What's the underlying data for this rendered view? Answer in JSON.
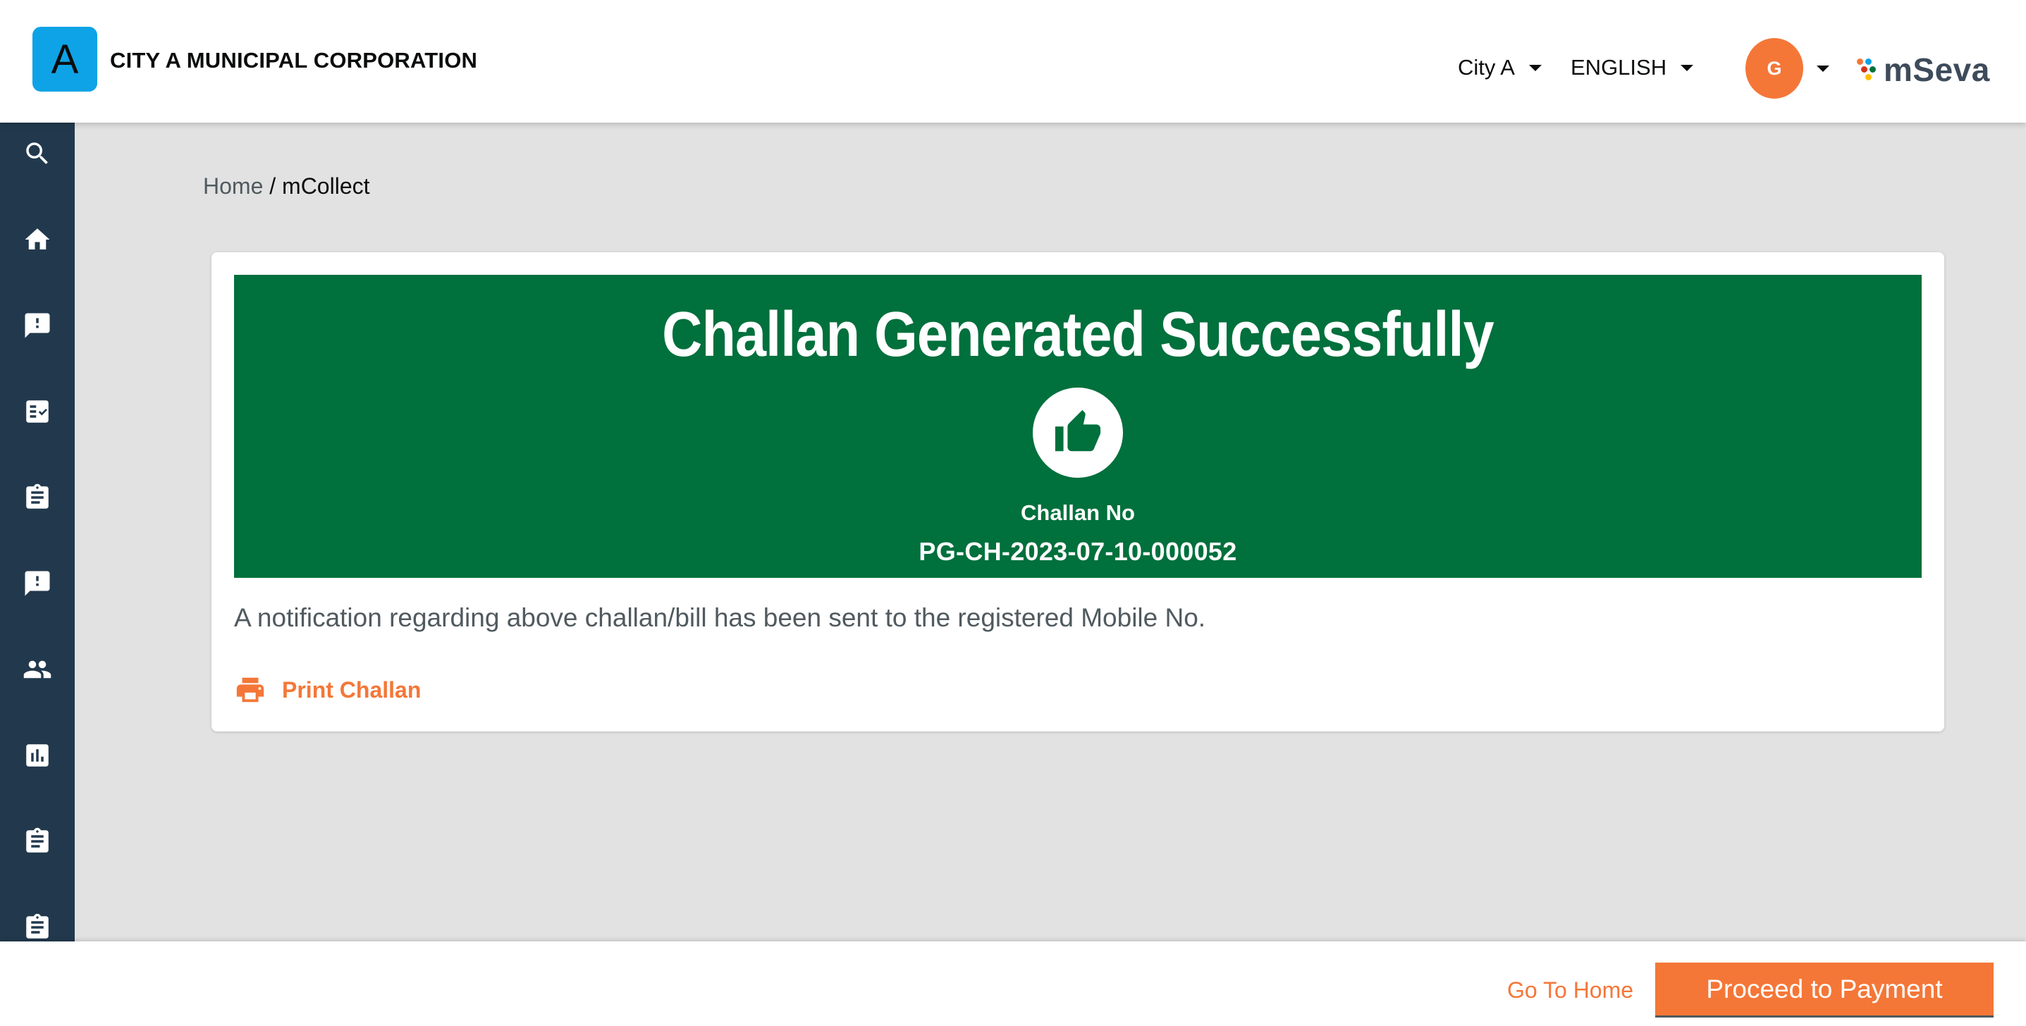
{
  "colors": {
    "primary": "#f47738",
    "success_banner": "#00703c",
    "sidebar": "#22394d",
    "city_logo": "#0ea3e6"
  },
  "header": {
    "city_logo_letter": "A",
    "city_name": "CITY A MUNICIPAL CORPORATION",
    "city_selector": "City A",
    "language_selector": "ENGLISH",
    "user_initial": "G",
    "brand": "mSeva"
  },
  "sidebar": {
    "items": [
      {
        "icon": "search-icon"
      },
      {
        "icon": "home-icon"
      },
      {
        "icon": "feedback-icon"
      },
      {
        "icon": "checklist-icon"
      },
      {
        "icon": "assignment-icon"
      },
      {
        "icon": "feedback-icon"
      },
      {
        "icon": "people-icon"
      },
      {
        "icon": "chart-icon"
      },
      {
        "icon": "assignment-icon"
      },
      {
        "icon": "assignment-icon"
      }
    ]
  },
  "breadcrumb": {
    "home": "Home",
    "separator": " / ",
    "current": "mCollect"
  },
  "banner": {
    "title": "Challan Generated Successfully",
    "icon": "thumbs-up-icon",
    "challan_label": "Challan No",
    "challan_number": "PG-CH-2023-07-10-000052"
  },
  "notification": "A notification regarding above challan/bill has been sent to the registered Mobile No.",
  "print_action": {
    "icon": "print-icon",
    "label": "Print Challan"
  },
  "footer": {
    "go_home": "Go To Home",
    "proceed": "Proceed to Payment"
  }
}
